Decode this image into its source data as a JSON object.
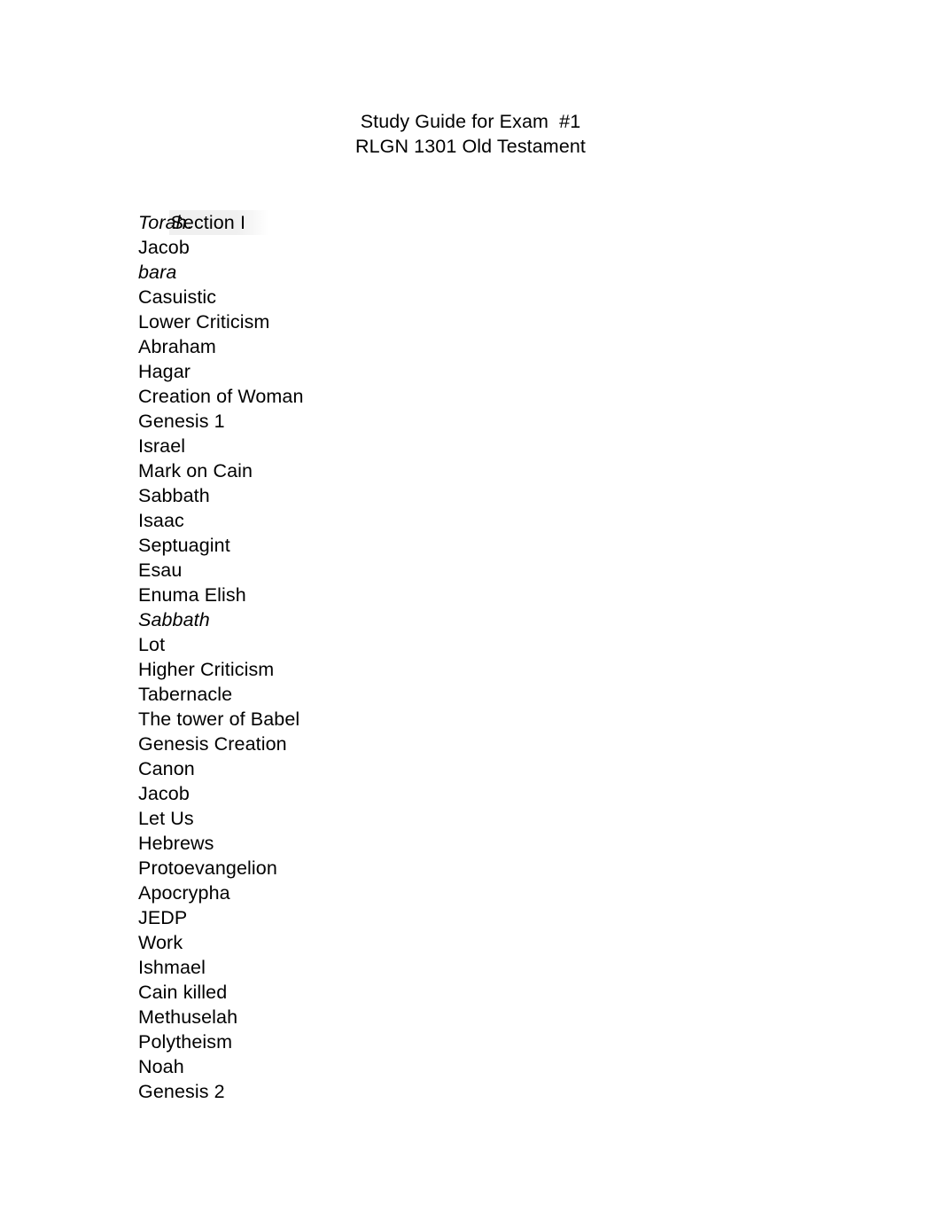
{
  "document": {
    "title_lines": [
      "Study Guide for Exam  #1",
      "RLGN 1301 Old Testament"
    ],
    "section_heading": "Section I",
    "colors": {
      "text": "#000000",
      "background": "#ffffff",
      "highlight": "#f0f0f0"
    },
    "terms": [
      {
        "text": "Torah",
        "style": "italic",
        "trailing": "."
      },
      {
        "text": "Jacob",
        "style": "normal",
        "trailing": ""
      },
      {
        "text": "bara",
        "style": "italic",
        "trailing": ""
      },
      {
        "text": "Casuistic",
        "style": "normal",
        "trailing": ""
      },
      {
        "text": "Lower Criticism",
        "style": "normal",
        "trailing": ""
      },
      {
        "text": "Abraham",
        "style": "normal",
        "trailing": ""
      },
      {
        "text": "Hagar",
        "style": "normal",
        "trailing": ""
      },
      {
        "text": "Creation of Woman",
        "style": "normal",
        "trailing": ""
      },
      {
        "text": "Genesis 1",
        "style": "normal",
        "trailing": ""
      },
      {
        "text": "Israel",
        "style": "normal",
        "trailing": ""
      },
      {
        "text": "Mark on Cain",
        "style": "normal",
        "trailing": ""
      },
      {
        "text": "Sabbath",
        "style": "normal",
        "trailing": ""
      },
      {
        "text": "Isaac",
        "style": "normal",
        "trailing": ""
      },
      {
        "text": "Septuagint",
        "style": "normal",
        "trailing": ""
      },
      {
        "text": "Esau",
        "style": "normal",
        "trailing": ""
      },
      {
        "text": "Enuma Elish",
        "style": "normal",
        "trailing": ""
      },
      {
        "text": "Sabbath",
        "style": "italic",
        "trailing": ""
      },
      {
        "text": "Lot",
        "style": "normal",
        "trailing": ""
      },
      {
        "text": "Higher Criticism",
        "style": "normal",
        "trailing": ""
      },
      {
        "text": "Tabernacle",
        "style": "normal",
        "trailing": ""
      },
      {
        "text": "The tower of Babel",
        "style": "normal",
        "trailing": ""
      },
      {
        "text": "Genesis Creation",
        "style": "normal",
        "trailing": ""
      },
      {
        "text": "Canon",
        "style": "normal",
        "trailing": ""
      },
      {
        "text": "Jacob",
        "style": "normal",
        "trailing": ""
      },
      {
        "text": "Let Us",
        "style": "normal",
        "trailing": ""
      },
      {
        "text": "Hebrews",
        "style": "normal",
        "trailing": ""
      },
      {
        "text": "Protoevangelion",
        "style": "normal",
        "trailing": ""
      },
      {
        "text": "Apocrypha",
        "style": "normal",
        "trailing": ""
      },
      {
        "text": "JEDP",
        "style": "normal",
        "trailing": ""
      },
      {
        "text": "Work",
        "style": "normal",
        "trailing": ""
      },
      {
        "text": "Ishmael",
        "style": "normal",
        "trailing": ""
      },
      {
        "text": "Cain killed",
        "style": "normal",
        "trailing": ""
      },
      {
        "text": "Methuselah",
        "style": "normal",
        "trailing": ""
      },
      {
        "text": "Polytheism",
        "style": "normal",
        "trailing": ""
      },
      {
        "text": "Noah",
        "style": "normal",
        "trailing": ""
      },
      {
        "text": "Genesis 2",
        "style": "normal",
        "trailing": ""
      }
    ]
  }
}
